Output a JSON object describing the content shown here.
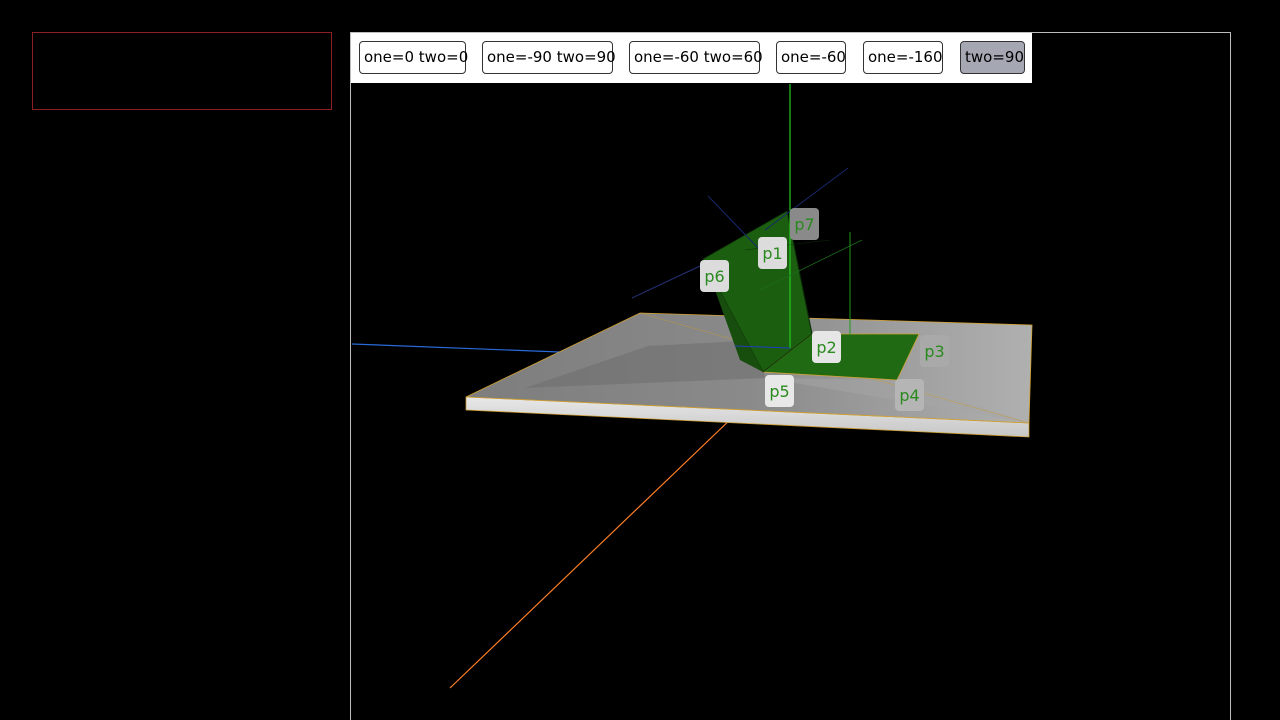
{
  "toolbar": {
    "buttons": [
      {
        "label": "one=0 two=0",
        "active": false
      },
      {
        "label": "one=-90 two=90",
        "active": false
      },
      {
        "label": "one=-60 two=60",
        "active": false
      },
      {
        "label": "one=-60",
        "active": false
      },
      {
        "label": "one=-160",
        "active": false
      },
      {
        "label": "two=90",
        "active": true
      }
    ]
  },
  "points": {
    "p1": "p1",
    "p2": "p2",
    "p3": "p3",
    "p4": "p4",
    "p5": "p5",
    "p6": "p6",
    "p7": "p7"
  },
  "colors": {
    "background": "#000000",
    "info_panel_border": "#8b2020",
    "viewport_border": "#bdbdbd",
    "active_button": "#a5a8b3",
    "panel_fill": "#2f7a1c",
    "plate": "#9a9a9a",
    "axis_x": "#ff7f27",
    "axis_y": "#22cc22",
    "axis_z": "#2a6ad9"
  }
}
